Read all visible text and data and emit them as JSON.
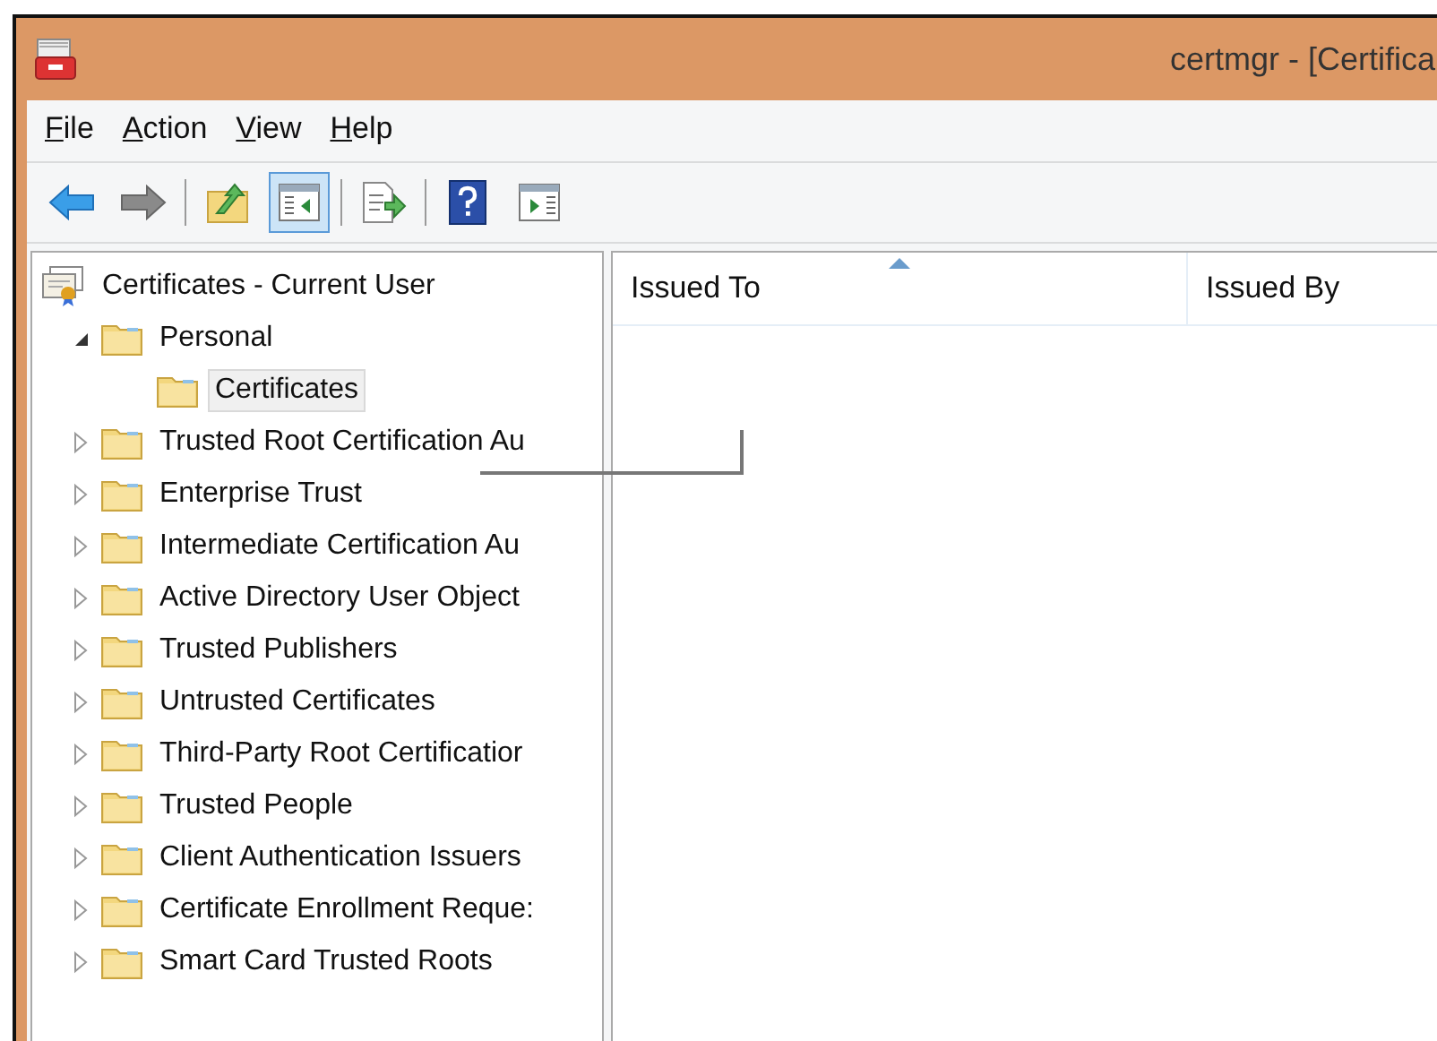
{
  "window": {
    "title": "certmgr - [Certifica"
  },
  "menu": [
    {
      "label": "File"
    },
    {
      "label": "Action"
    },
    {
      "label": "View"
    },
    {
      "label": "Help"
    }
  ],
  "toolbar": [
    {
      "kind": "back",
      "pressed": false
    },
    {
      "kind": "forward",
      "pressed": false
    },
    {
      "kind": "separator"
    },
    {
      "kind": "up",
      "pressed": false
    },
    {
      "kind": "tree",
      "pressed": true
    },
    {
      "kind": "separator"
    },
    {
      "kind": "export",
      "pressed": false
    },
    {
      "kind": "separator"
    },
    {
      "kind": "help",
      "pressed": false
    },
    {
      "kind": "actionpane",
      "pressed": false
    }
  ],
  "tree": {
    "label": "Certificates - Current User",
    "children": [
      {
        "label": "Personal",
        "expanded": true,
        "selected": false,
        "children": [
          {
            "label": "Certificates",
            "selected": true
          }
        ]
      },
      {
        "label": "Trusted Root Certification Au",
        "expanded": false,
        "selected": false
      },
      {
        "label": "Enterprise Trust",
        "expanded": false,
        "selected": false
      },
      {
        "label": "Intermediate Certification Au",
        "expanded": false,
        "selected": false
      },
      {
        "label": "Active Directory User Object",
        "expanded": false,
        "selected": false
      },
      {
        "label": "Trusted Publishers",
        "expanded": false,
        "selected": false
      },
      {
        "label": "Untrusted Certificates",
        "expanded": false,
        "selected": false
      },
      {
        "label": "Third-Party Root Certificatior",
        "expanded": false,
        "selected": false
      },
      {
        "label": "Trusted People",
        "expanded": false,
        "selected": false
      },
      {
        "label": "Client Authentication Issuers",
        "expanded": false,
        "selected": false
      },
      {
        "label": "Certificate Enrollment Reque:",
        "expanded": false,
        "selected": false
      },
      {
        "label": "Smart Card Trusted Roots",
        "expanded": false,
        "selected": false
      }
    ]
  },
  "table": {
    "columns": [
      {
        "label": "Issued To",
        "sorted": true
      },
      {
        "label": "Issued By",
        "sorted": false
      }
    ]
  }
}
